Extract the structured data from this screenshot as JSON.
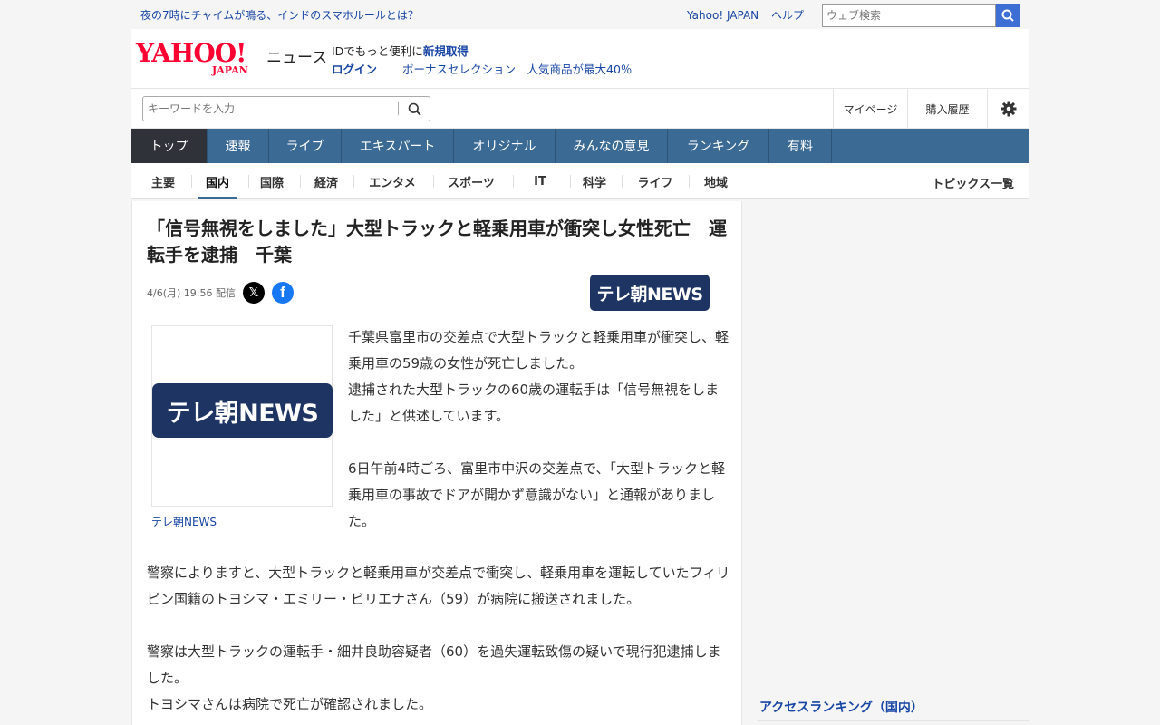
{
  "topbar": {
    "ticker": "夜の7時にチャイムが鳴る、インドのスマホルールとは？",
    "links": [
      "Yahoo! JAPAN",
      "ヘルプ"
    ],
    "web_search_placeholder": "ウェブ検索"
  },
  "masthead": {
    "logo_main": "YAHOO!",
    "logo_sub": "JAPAN",
    "logo_service": "ニュース",
    "promo_line1_prefix": "IDでもっと便利に",
    "promo_line1_link": "新規取得",
    "promo_login": "ログイン",
    "promo_line2_link": "ボーナスセレクション　人気商品が最大40％"
  },
  "search": {
    "placeholder": "キーワードを入力",
    "util": [
      "マイページ",
      "購入履歴"
    ]
  },
  "main_nav": [
    "トップ",
    "速報",
    "ライブ",
    "エキスパート",
    "オリジナル",
    "みんなの意見",
    "ランキング",
    "有料"
  ],
  "sub_nav": [
    "主要",
    "国内",
    "国際",
    "経済",
    "エンタメ",
    "スポーツ",
    "IT",
    "科学",
    "ライフ",
    "地域"
  ],
  "sub_nav_right": "トピックス一覧",
  "article": {
    "headline": "「信号無視をしました」大型トラックと軽乗用車が衝突し女性死亡　運転手を逮捕　千葉",
    "date": "4/6(月) 19:56 配信",
    "provider_logo": "テレ朝NEWS",
    "image_badge": "テレ朝NEWS",
    "caption": "テレ朝NEWS",
    "p1a": "千葉県富里市の交差点で大型トラックと軽乗用車が衝突し、軽乗用車の59歳の女性が死亡しました。",
    "p1b": "逮捕された大型トラックの60歳の運転手は「信号無視をしました」と供述しています。",
    "p2": "6日午前4時ごろ、富里市中沢の交差点で、「大型トラックと軽乗用車の事故でドアが開かず意識がない」と通報がありました。",
    "p3": "警察によりますと、大型トラックと軽乗用車が交差点で衝突し、軽乗用車を運転していたフィリピン国籍のトヨシマ・エミリー・ビリエナさん（59）が病院に搬送されました。",
    "p4a": "警察は大型トラックの運転手・細井良助容疑者（60）を過失運転致傷の疑いで現行犯逮捕しました。",
    "p4b": "トヨシマさんは病院で死亡が確認されました。"
  },
  "sidebar": {
    "ranking_title": "アクセスランキング（国内）"
  }
}
